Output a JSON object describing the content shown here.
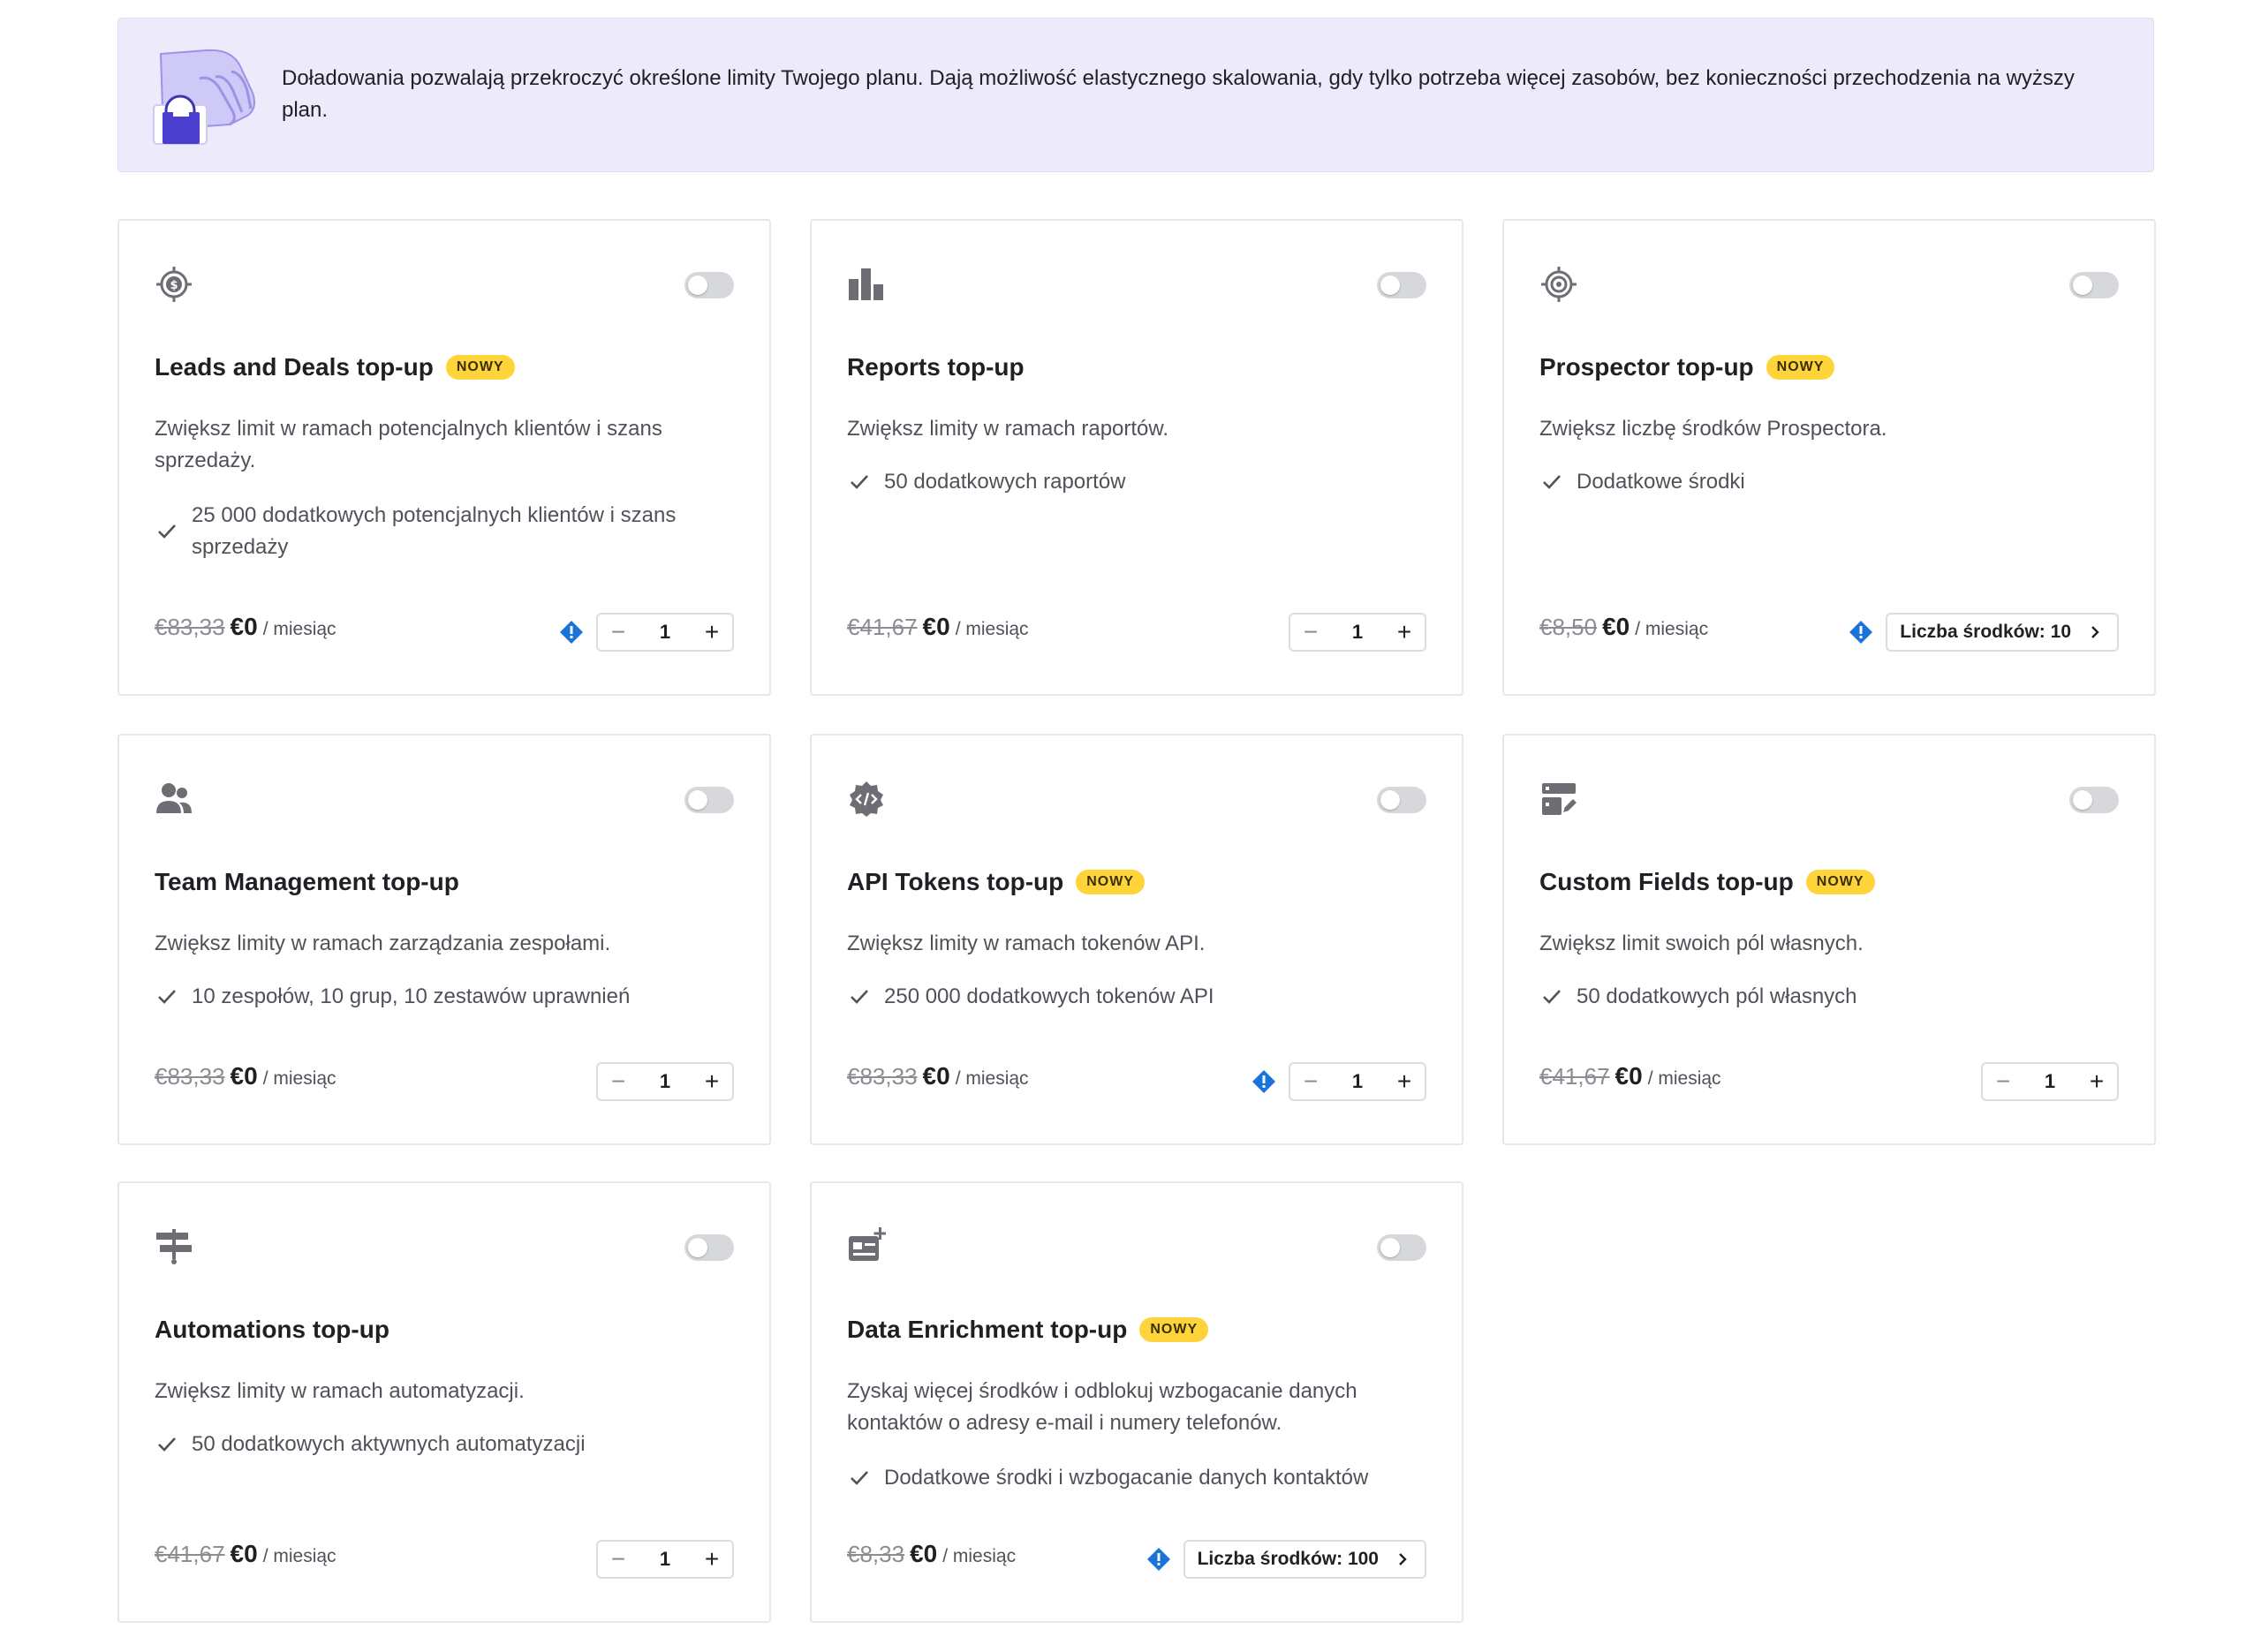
{
  "banner": {
    "text": "Doładowania pozwalają przekroczyć określone limity Twojego planu. Dają możliwość elastycznego skalowania, gdy tylko potrzeba więcej zasobów, bez konieczności przechodzenia na wyższy plan."
  },
  "common": {
    "period": "/ miesiąc",
    "badge": "NOWY"
  },
  "cards": [
    {
      "title": "Leads and Deals top-up",
      "icon": "target-dollar-icon",
      "new": true,
      "description": "Zwiększ limit w ramach potencjalnych klientów i szans sprzedaży.",
      "feature": "25 000 dodatkowych potencjalnych klientów i szans sprzedaży",
      "old_price": "€83,33",
      "price": "€0",
      "has_info": true,
      "quantity": "1",
      "toggle_on": false
    },
    {
      "title": "Reports top-up",
      "icon": "bar-chart-icon",
      "new": false,
      "description": "Zwiększ limity w ramach raportów.",
      "feature": "50 dodatkowych raportów",
      "old_price": "€41,67",
      "price": "€0",
      "has_info": false,
      "quantity": "1",
      "toggle_on": false
    },
    {
      "title": "Prospector top-up",
      "icon": "target-icon",
      "new": true,
      "description": "Zwiększ liczbę środków Prospectora.",
      "feature": "Dodatkowe środki",
      "old_price": "€8,50",
      "price": "€0",
      "has_info": true,
      "credits_label": "Liczba środków: 10",
      "toggle_on": false
    },
    {
      "title": "Team Management top-up",
      "icon": "users-icon",
      "new": false,
      "description": "Zwiększ limity w ramach zarządzania zespołami.",
      "feature": "10 zespołów, 10 grup, 10 zestawów uprawnień",
      "old_price": "€83,33",
      "price": "€0",
      "has_info": false,
      "quantity": "1",
      "toggle_on": false
    },
    {
      "title": "API Tokens top-up",
      "icon": "api-gear-icon",
      "new": true,
      "description": "Zwiększ limity w ramach tokenów API.",
      "feature": "250 000 dodatkowych tokenów API",
      "old_price": "€83,33",
      "price": "€0",
      "has_info": true,
      "quantity": "1",
      "toggle_on": false
    },
    {
      "title": "Custom Fields top-up",
      "icon": "custom-fields-icon",
      "new": true,
      "description": "Zwiększ limit swoich pól własnych.",
      "feature": "50 dodatkowych pól własnych",
      "old_price": "€41,67",
      "price": "€0",
      "has_info": false,
      "quantity": "1",
      "toggle_on": false
    },
    {
      "title": "Automations top-up",
      "icon": "automation-signpost-icon",
      "new": false,
      "description": "Zwiększ limity w ramach automatyzacji.",
      "feature": "50 dodatkowych aktywnych automatyzacji",
      "old_price": "€41,67",
      "price": "€0",
      "has_info": false,
      "quantity": "1",
      "toggle_on": false
    },
    {
      "title": "Data Enrichment top-up",
      "icon": "contact-card-plus-icon",
      "new": true,
      "description": "Zyskaj więcej środków i odblokuj wzbogacanie danych kontaktów o adresy e-mail i numery telefonów.",
      "feature": "Dodatkowe środki i wzbogacanie danych kontaktów",
      "old_price": "€8,33",
      "price": "€0",
      "has_info": true,
      "credits_label": "Liczba środków: 100",
      "toggle_on": false
    }
  ],
  "colors": {
    "banner_bg": "#eceafb",
    "badge_bg": "#ffd43b",
    "info_blue": "#1a73d9",
    "icon_gray": "#6c6e74",
    "toggle_off": "#d7d8db"
  }
}
